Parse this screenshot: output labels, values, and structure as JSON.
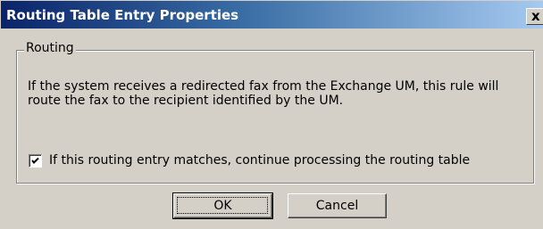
{
  "window": {
    "title": "Routing Table Entry Properties",
    "close_glyph": "x"
  },
  "group": {
    "label": "Routing",
    "description": "If the system receives a redirected fax from the Exchange UM, this rule will route the fax to the recipient identified by the UM.",
    "checkbox": {
      "label": "If this routing entry matches, continue processing the routing table",
      "checked": true
    }
  },
  "buttons": {
    "ok_label": "OK",
    "cancel_label": "Cancel"
  },
  "colors": {
    "title_start": "#0a246a",
    "title_end": "#a6caf0",
    "face": "#d4d0c8"
  },
  "icons": {
    "close": "close-icon",
    "check": "checkmark-icon"
  }
}
